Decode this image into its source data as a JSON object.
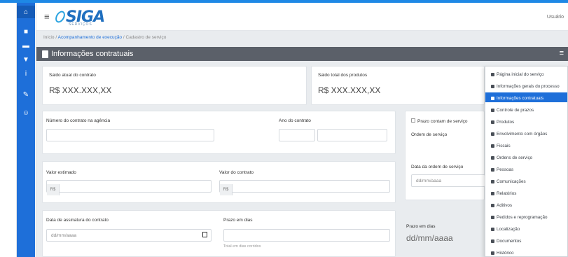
{
  "app": {
    "logo_text": "SIGA",
    "logo_sub": "SERVIÇOS",
    "user_link": "Usuário"
  },
  "breadcrumb": {
    "home": "Início",
    "sep": "/",
    "section": "Acompanhamento de execução",
    "current": "Cadastro de serviço"
  },
  "panel": {
    "title": "Informações contratuais",
    "menu_icon": "≡"
  },
  "fields": {
    "saldo_atual_label": "Saldo atual do contrato",
    "saldo_atual_value": "R$ XXX.XXX,XX",
    "saldo_total_label": "Saldo total dos produtos",
    "saldo_total_value": "R$ XXX.XXX,XX",
    "numero_contrato_label": "Número do contrato na agência",
    "ano_label": "Ano do contrato",
    "prazo_check_label": "Prazo contam de serviço",
    "ordem_label": "Ordem de serviço",
    "data_ordem_label": "Data da ordem de serviço",
    "data_ordem_placeholder": "dd/mm/aaaa",
    "valor_estimado_label": "Valor estimado",
    "valor_estimado_prefix": "R$",
    "valor_contrato_label": "Valor do contrato",
    "valor_contrato_prefix": "R$",
    "data_assinatura_label": "Data de assinatura do contrato",
    "data_assinatura_placeholder": "dd/mm/aaaa",
    "prazo_dias_label": "Prazo em dias",
    "prazo_dias_hint": "Total em dias corridos",
    "prazo_em_dias_label": "Prazo em dias",
    "prazo_em_dias_value": "dd/mm/aaaa"
  },
  "dropdown": {
    "items": [
      "Página inicial do serviço",
      "Informações gerais do processo",
      "Informações contratuais",
      "Controle de prazos",
      "Produtos",
      "Envolvimento com órgãos",
      "Fiscais",
      "Ordens de serviço",
      "Pessoas",
      "Comunicações",
      "Relatórios",
      "Aditivos",
      "Pedidos e reprogramação",
      "Localização",
      "Documentos",
      "Histórico"
    ],
    "selected_index": 2
  },
  "colors": {
    "accent": "#1e6fd9",
    "panel_bar": "#5b6069"
  }
}
